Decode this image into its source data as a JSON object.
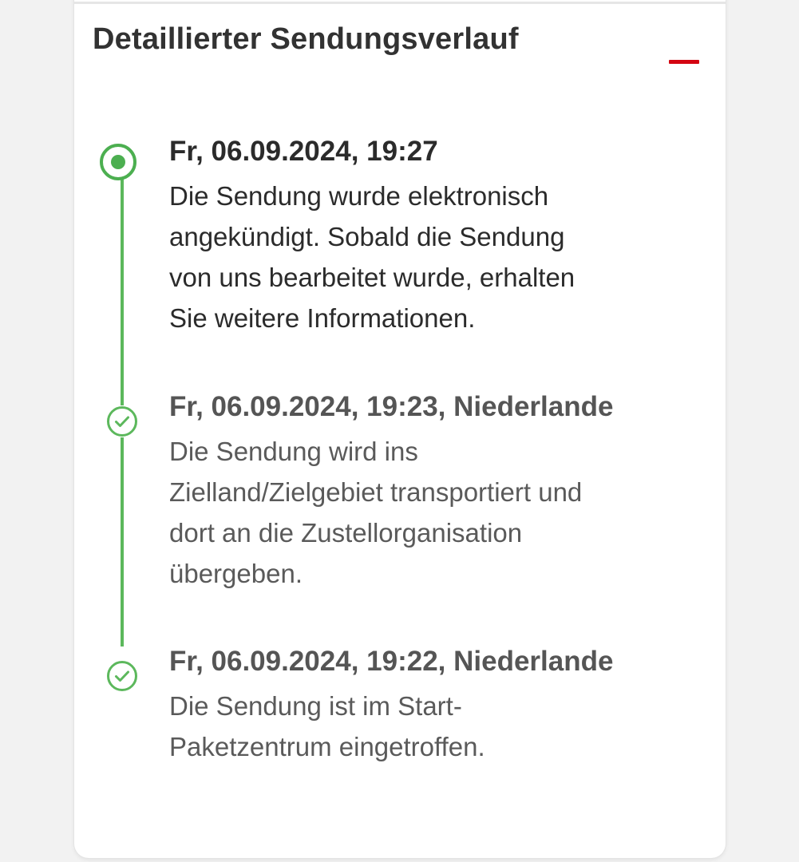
{
  "tracking": {
    "section_title": "Detaillierter Sendungsverlauf",
    "collapse_icon": "minus-icon",
    "accent_color": "#d40511",
    "timeline_color": "#4caf50",
    "events": [
      {
        "date": "Fr, 06.09.2024, 19:27",
        "description": "Die Sendung wurde elektronisch\nangekündigt. Sobald die Sendung\nvon uns bearbeitet wurde, erhalten\nSie weitere Informationen.",
        "status_icon": "current-status-dot-icon"
      },
      {
        "date": "Fr, 06.09.2024, 19:23, Niederlande",
        "description": "Die Sendung wird ins\nZielland/Zielgebiet transportiert und\ndort an die Zustellorganisation\nübergeben.",
        "status_icon": "check-circle-icon"
      },
      {
        "date": "Fr, 06.09.2024, 19:22, Niederlande",
        "description": "Die Sendung ist im Start-\nPaketzentrum eingetroffen.",
        "status_icon": "check-circle-icon"
      }
    ]
  }
}
